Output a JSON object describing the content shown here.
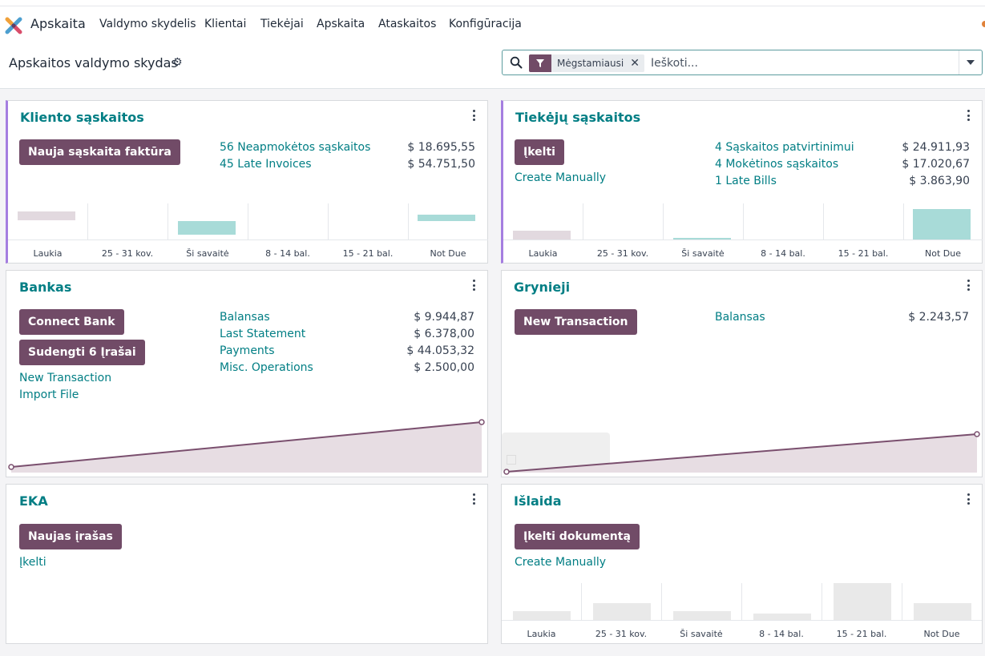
{
  "navbar": {
    "app_name": "Apskaita",
    "items": [
      "Valdymo skydelis",
      "Klientai",
      "Tiekėjai",
      "Apskaita",
      "Ataskaitos",
      "Konfigūracija"
    ]
  },
  "control": {
    "page_title": "Apskaitos valdymo skydas",
    "facet_label": "Mėgstamiausi",
    "search_placeholder": "Ieškoti..."
  },
  "cards": {
    "klientai": {
      "title": "Kliento sąskaitos",
      "button": "Nauja sąskaita faktūra",
      "links": [
        "56 Neapmokėtos sąskaitos",
        "45 Late Invoices"
      ],
      "amounts": [
        "$ 18.695,55",
        "$ 54.751,50"
      ],
      "axis": [
        "Laukia",
        "25 - 31 kov.",
        "Ši savaitė",
        "8 - 14 bal.",
        "15 - 21 bal.",
        "Not Due"
      ]
    },
    "tiekejai": {
      "title": "Tiekėjų sąskaitos",
      "button": "Įkelti",
      "extra_link": "Create Manually",
      "links": [
        "4 Sąskaitos patvirtinimui",
        "4 Mokėtinos sąskaitos",
        "1 Late Bills"
      ],
      "amounts": [
        "$ 24.911,93",
        "$ 17.020,67",
        "$ 3.863,90"
      ],
      "axis": [
        "Laukia",
        "25 - 31 kov.",
        "Ši savaitė",
        "8 - 14 bal.",
        "15 - 21 bal.",
        "Not Due"
      ]
    },
    "bankas": {
      "title": "Bankas",
      "buttons": [
        "Connect Bank",
        "Sudengti 6 Įrašai"
      ],
      "extra_links": [
        "New Transaction",
        "Import File"
      ],
      "links": [
        "Balansas",
        "Last Statement",
        "Payments",
        "Misc. Operations"
      ],
      "amounts": [
        "$ 9.944,87",
        "$ 6.378,00",
        "$ 44.053,32",
        "$ 2.500,00"
      ]
    },
    "grynieji": {
      "title": "Grynieji",
      "button": "New Transaction",
      "links": [
        "Balansas"
      ],
      "amounts": [
        "$ 2.243,57"
      ]
    },
    "eka": {
      "title": "EKA",
      "button": "Naujas įrašas",
      "extra_link": "Įkelti"
    },
    "islaida": {
      "title": "Išlaida",
      "button": "Įkelti dokumentą",
      "extra_link": "Create Manually",
      "axis": [
        "Laukia",
        "25 - 31 kov.",
        "Ši savaitė",
        "8 - 14 bal.",
        "15 - 21 bal.",
        "Not Due"
      ]
    }
  },
  "colors": {
    "primary": "#714b67",
    "link": "#017e84",
    "bar_past": "#e2d9df",
    "bar_future": "#a8dbd8",
    "bar_empty": "#e9e9e9",
    "line": "#7a4f6e",
    "area": "#e7dde3"
  }
}
